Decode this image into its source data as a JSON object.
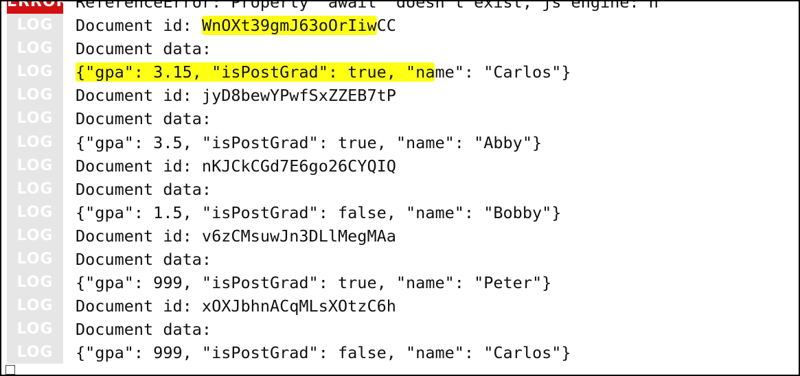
{
  "console": {
    "top_line": {
      "level": "ERROR",
      "text": "ReferenceError: Property 'await' doesn't exist, js engine: h"
    },
    "lines": [
      {
        "level": "LOG",
        "pre": "Document id: ",
        "highlight": "WnOXt39gmJ63oOrIiw",
        "post": "CC"
      },
      {
        "level": "LOG",
        "pre": "Document data:",
        "highlight": "",
        "post": ""
      },
      {
        "level": "LOG",
        "pre": "",
        "highlight": "{\"gpa\": 3.15, \"isPostGrad\": true, \"na",
        "post": "me\": \"Carlos\"}"
      },
      {
        "level": "LOG",
        "pre": "Document id: jyD8bewYPwfSxZZEB7tP",
        "highlight": "",
        "post": ""
      },
      {
        "level": "LOG",
        "pre": "Document data:",
        "highlight": "",
        "post": ""
      },
      {
        "level": "LOG",
        "pre": "{\"gpa\": 3.5, \"isPostGrad\": true, \"name\": \"Abby\"}",
        "highlight": "",
        "post": ""
      },
      {
        "level": "LOG",
        "pre": "Document id: nKJCkCGd7E6go26CYQIQ",
        "highlight": "",
        "post": ""
      },
      {
        "level": "LOG",
        "pre": "Document data:",
        "highlight": "",
        "post": ""
      },
      {
        "level": "LOG",
        "pre": "{\"gpa\": 1.5, \"isPostGrad\": false, \"name\": \"Bobby\"}",
        "highlight": "",
        "post": ""
      },
      {
        "level": "LOG",
        "pre": "Document id: v6zCMsuwJn3DLlMegMAa",
        "highlight": "",
        "post": ""
      },
      {
        "level": "LOG",
        "pre": "Document data:",
        "highlight": "",
        "post": ""
      },
      {
        "level": "LOG",
        "pre": "{\"gpa\": 999, \"isPostGrad\": true, \"name\": \"Peter\"}",
        "highlight": "",
        "post": ""
      },
      {
        "level": "LOG",
        "pre": "Document id: xOXJbhnACqMLsXOtzC6h",
        "highlight": "",
        "post": ""
      },
      {
        "level": "LOG",
        "pre": "Document data:",
        "highlight": "",
        "post": ""
      },
      {
        "level": "LOG",
        "pre": "{\"gpa\": 999, \"isPostGrad\": false, \"name\": \"Carlos\"}",
        "highlight": "",
        "post": ""
      }
    ]
  },
  "colors": {
    "error_badge": "#d40f0f",
    "log_gutter": "#e6e6e6",
    "highlight": "#ffff14"
  }
}
